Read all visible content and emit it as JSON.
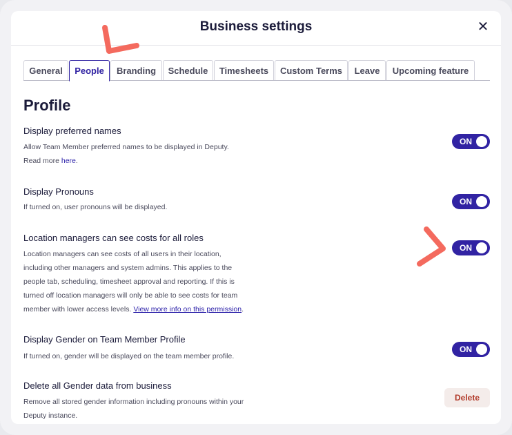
{
  "modal": {
    "title": "Business settings",
    "close_label": "✕"
  },
  "tabs": [
    {
      "label": "General"
    },
    {
      "label": "People",
      "active": true
    },
    {
      "label": "Branding"
    },
    {
      "label": "Schedule"
    },
    {
      "label": "Timesheets"
    },
    {
      "label": "Custom Terms"
    },
    {
      "label": "Leave"
    },
    {
      "label": "Upcoming feature"
    }
  ],
  "section": {
    "title": "Profile"
  },
  "settings": [
    {
      "title": "Display preferred names",
      "desc_1": "Allow Team Member preferred names to be displayed in Deputy.",
      "desc_2_prefix": "Read more ",
      "desc_link": "here",
      "desc_2_suffix": ".",
      "toggle": "ON"
    },
    {
      "title": "Display Pronouns",
      "desc": "If turned on, user pronouns will be displayed.",
      "toggle": "ON"
    },
    {
      "title": "Location managers can see costs for all roles",
      "desc_lines": [
        "Location managers can see costs of all users in their location,",
        "including other managers and system admins. This applies to the",
        "people tab, scheduling, timesheet approval and reporting. If this is",
        "turned off location managers will only be able to see costs for team"
      ],
      "desc_last_prefix": "member with lower access levels. ",
      "desc_link": "View more info on this permission",
      "desc_last_suffix": ".",
      "toggle": "ON"
    },
    {
      "title": "Display Gender on Team Member Profile",
      "desc": "If turned on, gender will be displayed on the team member profile.",
      "toggle": "ON"
    },
    {
      "title": "Delete all Gender data from business",
      "desc_lines": [
        "Remove all stored gender information including pronouns within your",
        "Deputy instance."
      ],
      "button": "Delete"
    }
  ],
  "colors": {
    "accent": "#3123a3",
    "annotation": "#f46a5e",
    "delete_text": "#b13a2a",
    "delete_bg": "#f4ecea"
  }
}
